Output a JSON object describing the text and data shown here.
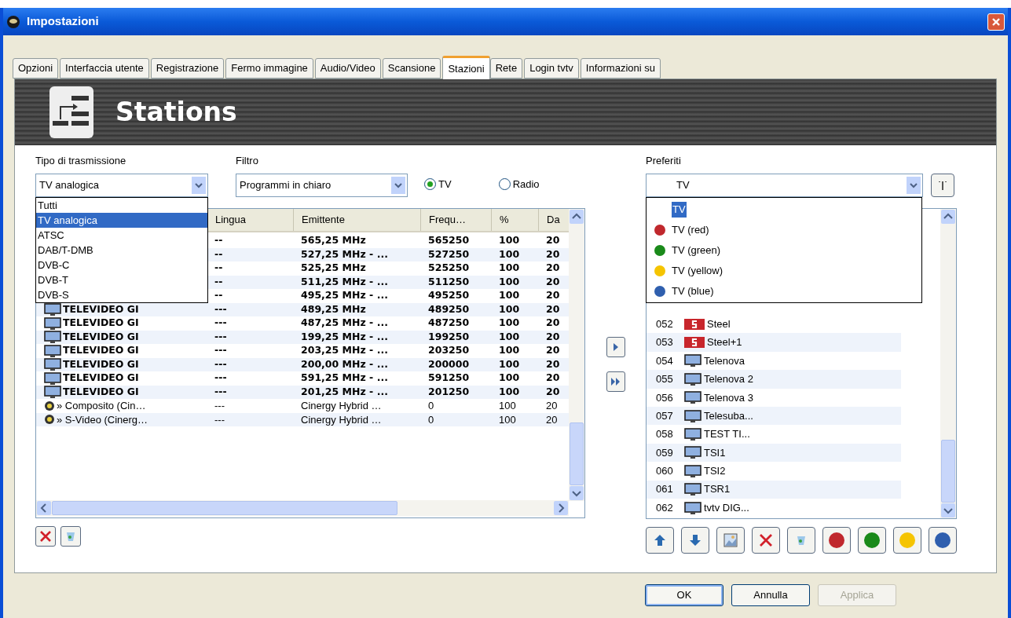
{
  "window": {
    "title": "Impostazioni"
  },
  "tabs": [
    {
      "label": "Opzioni",
      "selected": false
    },
    {
      "label": "Interfaccia utente",
      "selected": false
    },
    {
      "label": "Registrazione",
      "selected": false
    },
    {
      "label": "Fermo immagine",
      "selected": false
    },
    {
      "label": "Audio/Video",
      "selected": false
    },
    {
      "label": "Scansione",
      "selected": false
    },
    {
      "label": "Stazioni",
      "selected": true
    },
    {
      "label": "Rete",
      "selected": false
    },
    {
      "label": "Login tvtv",
      "selected": false
    },
    {
      "label": "Informazioni su",
      "selected": false
    }
  ],
  "banner": {
    "title": "Stations"
  },
  "transmission": {
    "label": "Tipo di trasmissione",
    "value": "TV analogica",
    "options": [
      {
        "label": "Tutti",
        "selected": false
      },
      {
        "label": "TV analogica",
        "selected": true
      },
      {
        "label": "ATSC",
        "selected": false
      },
      {
        "label": "DAB/T-DMB",
        "selected": false
      },
      {
        "label": "DVB-C",
        "selected": false
      },
      {
        "label": "DVB-T",
        "selected": false
      },
      {
        "label": "DVB-S",
        "selected": false
      }
    ]
  },
  "filter": {
    "label": "Filtro",
    "value": "Programmi in chiaro"
  },
  "mode": [
    {
      "label": "TV",
      "selected": true
    },
    {
      "label": "Radio",
      "selected": false
    }
  ],
  "table": {
    "columns": [
      "Lingua",
      "Emittente",
      "Frequ…",
      "%",
      "Da"
    ],
    "rows": [
      {
        "kind": "tv",
        "cells": [
          "--",
          "565,25 MHz",
          "565250",
          "100",
          "20"
        ]
      },
      {
        "kind": "tv",
        "cells": [
          "--",
          "527,25 MHz - ...",
          "527250",
          "100",
          "20"
        ]
      },
      {
        "kind": "tv",
        "cells": [
          "--",
          "525,25 MHz",
          "525250",
          "100",
          "20"
        ]
      },
      {
        "kind": "tv",
        "cells": [
          "--",
          "511,25 MHz - ...",
          "511250",
          "100",
          "20"
        ]
      },
      {
        "kind": "tv",
        "cells": [
          "--",
          "495,25 MHz - ...",
          "495250",
          "100",
          "20"
        ]
      },
      {
        "kind": "tv",
        "name": "TELEVIDEO GI",
        "cells": [
          "---",
          "489,25 MHz",
          "489250",
          "100",
          "20"
        ]
      },
      {
        "kind": "tv",
        "name": "TELEVIDEO GI",
        "cells": [
          "---",
          "487,25 MHz - ...",
          "487250",
          "100",
          "20"
        ]
      },
      {
        "kind": "tv",
        "name": "TELEVIDEO GI",
        "cells": [
          "---",
          "199,25 MHz - ...",
          "199250",
          "100",
          "20"
        ]
      },
      {
        "kind": "tv",
        "name": "TELEVIDEO GI",
        "cells": [
          "---",
          "203,25 MHz - ...",
          "203250",
          "100",
          "20"
        ]
      },
      {
        "kind": "tv",
        "name": "TELEVIDEO GI",
        "cells": [
          "---",
          "200,00 MHz - ...",
          "200000",
          "100",
          "20"
        ]
      },
      {
        "kind": "tv",
        "name": "TELEVIDEO GI",
        "cells": [
          "---",
          "591,25 MHz - ...",
          "591250",
          "100",
          "20"
        ]
      },
      {
        "kind": "tv",
        "name": "TELEVIDEO GI",
        "cells": [
          "---",
          "201,25 MHz - ...",
          "201250",
          "100",
          "20"
        ]
      },
      {
        "kind": "source",
        "name": "» Composito (Cin…",
        "cells": [
          "---",
          "Cinergy Hybrid …",
          "0",
          "100",
          "20"
        ]
      },
      {
        "kind": "source",
        "name": "» S-Video (Cinerg…",
        "cells": [
          "---",
          "Cinergy Hybrid …",
          "0",
          "100",
          "20"
        ]
      }
    ]
  },
  "favorites": {
    "label": "Preferiti",
    "value": "TV",
    "options": [
      {
        "label": "TV",
        "selected": true
      },
      {
        "label": "TV (red)",
        "color": "#c0282d",
        "selected": false
      },
      {
        "label": "TV (green)",
        "color": "#1a8a1a",
        "selected": false
      },
      {
        "label": "TV (yellow)",
        "color": "#f5c400",
        "selected": false
      },
      {
        "label": "TV (blue)",
        "color": "#2f5fae",
        "selected": false
      }
    ],
    "channels": [
      {
        "number": "052",
        "name": "Steel",
        "kind": "steel"
      },
      {
        "number": "053",
        "name": "Steel+1",
        "kind": "steel"
      },
      {
        "number": "054",
        "name": "Telenova",
        "kind": "tv"
      },
      {
        "number": "055",
        "name": "Telenova 2",
        "kind": "tv"
      },
      {
        "number": "056",
        "name": "Telenova 3",
        "kind": "tv"
      },
      {
        "number": "057",
        "name": "Telesuba...",
        "kind": "tv"
      },
      {
        "number": "058",
        "name": "TEST TI...",
        "kind": "tv"
      },
      {
        "number": "059",
        "name": "TSI1",
        "kind": "tv"
      },
      {
        "number": "060",
        "name": "TSI2",
        "kind": "tv"
      },
      {
        "number": "061",
        "name": "TSR1",
        "kind": "tv"
      },
      {
        "number": "062",
        "name": "tvtv DIG...",
        "kind": "tv"
      }
    ]
  },
  "buttons": [
    {
      "label": "OK",
      "default": true,
      "disabled": false
    },
    {
      "label": "Annulla",
      "default": false,
      "disabled": false
    },
    {
      "label": "Applica",
      "default": false,
      "disabled": true
    }
  ]
}
